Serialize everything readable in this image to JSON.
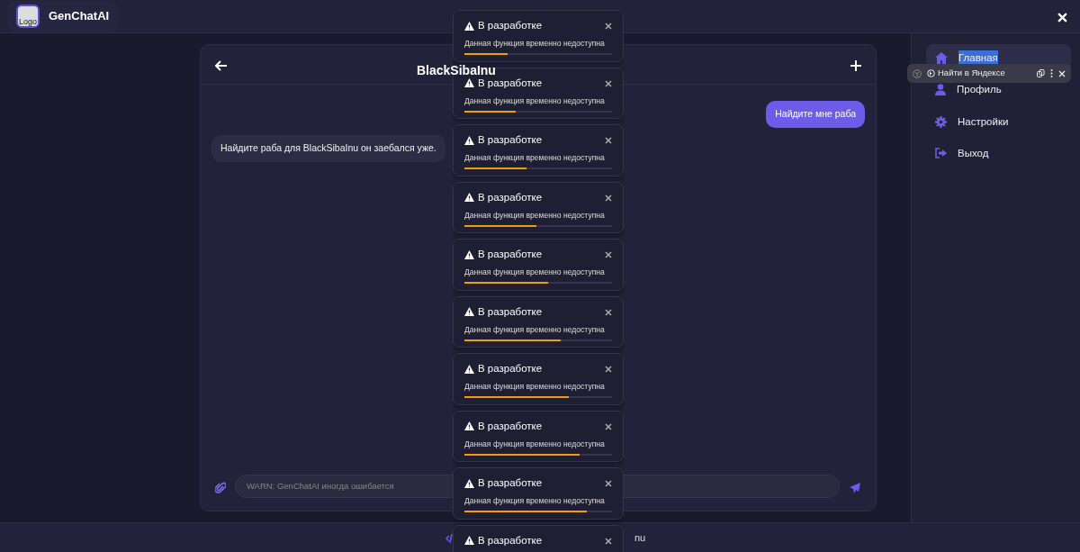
{
  "app": {
    "title": "GenChatAI",
    "logo_alt": "Logo"
  },
  "chat": {
    "title": "BlackSibaInu",
    "messages": [
      {
        "kind": "sent",
        "text": "Найдите мне раба"
      },
      {
        "kind": "received",
        "text": "Найдите раба для BlackSibaInu он заебался уже."
      }
    ],
    "input": {
      "placeholder": "WARN: GenChatAI иногда ошибается"
    }
  },
  "sidebar": {
    "items": [
      {
        "label": "Главная",
        "selected": true
      },
      {
        "label": "Профиль",
        "selected": false
      },
      {
        "label": "Настройки",
        "selected": false
      },
      {
        "label": "Выход",
        "selected": false
      }
    ]
  },
  "footer": {
    "text": "nu"
  },
  "browser_popup": {
    "action": "Найти в Яндексе"
  },
  "toasts": [
    {
      "title": "В разработке",
      "message": "Данная функция временно недоступна",
      "level": 0.29
    },
    {
      "title": "В разработке",
      "message": "Данная функция временно недоступна",
      "level": 0.35
    },
    {
      "title": "В разработке",
      "message": "Данная функция временно недоступна",
      "level": 0.42
    },
    {
      "title": "В разработке",
      "message": "Данная функция временно недоступна",
      "level": 0.49
    },
    {
      "title": "В разработке",
      "message": "Данная функция временно недоступна",
      "level": 0.57
    },
    {
      "title": "В разработке",
      "message": "Данная функция временно недоступна",
      "level": 0.65
    },
    {
      "title": "В разработке",
      "message": "Данная функция временно недоступна",
      "level": 0.71
    },
    {
      "title": "В разработке",
      "message": "Данная функция временно недоступна",
      "level": 0.78
    },
    {
      "title": "В разработке",
      "message": "Данная функция временно недоступна",
      "level": 0.83
    },
    {
      "title": "В разработке"
    }
  ]
}
